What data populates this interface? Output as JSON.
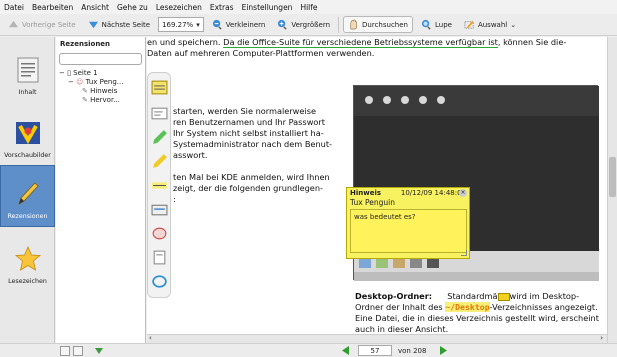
{
  "menubar": {
    "items": [
      "Datei",
      "Bearbeiten",
      "Ansicht",
      "Gehe zu",
      "Lesezeichen",
      "Extras",
      "Einstellungen",
      "Hilfe"
    ]
  },
  "toolbar": {
    "prev_page": "Vorherige Seite",
    "next_page": "Nächste Seite",
    "zoom": "169.27%",
    "zoom_out": "Verkleinern",
    "zoom_in": "Vergrößern",
    "browse": "Durchsuchen",
    "magnifier": "Lupe",
    "selection": "Auswahl"
  },
  "sidebar": {
    "items": [
      "Inhalt",
      "Vorschaubilder",
      "Rezensionen",
      "Lesezeichen"
    ],
    "selected": "Rezensionen"
  },
  "panel": {
    "title": "Rezensionen",
    "tree": [
      "Seite 1",
      "Tux Peng...",
      "Hinweis",
      "Hervor..."
    ]
  },
  "document": {
    "line1_pre": "en und speichern. ",
    "line1_link": "Da die Office-Suite für verschiedene Betriebssysteme verfügbar ist",
    "line1_post": ", können Sie die-",
    "line2": "Daten auf mehreren Computer-Plattformen verwenden.",
    "para1": [
      "starten, werden Sie normalerweise",
      "ren Benutzernamen und Ihr Passwort",
      "Ihr System nicht selbst installiert ha-",
      "Systemadministrator nach dem Benut-",
      "asswort."
    ],
    "para2": [
      "ten Mal bei KDE anmelden, wird Ihnen",
      "zeigt, der die folgenden grundlegen-",
      ":"
    ],
    "desktop_heading": "Desktop-Ordner:",
    "desktop_line1_pre": "Standardmä",
    "desktop_line1_post": "wird im Desktop-",
    "desktop_line2_pre": "Ordner der Inhalt des ",
    "desktop_path": "~/Desktop",
    "desktop_line2_post": "-Verzeichnisses angezeigt.",
    "desktop_line3": "Eine Datei, die in dieses Verzeichnis gestellt wird, erscheint",
    "desktop_line4": "auch in dieser Ansicht."
  },
  "note": {
    "title": "Hinweis",
    "timestamp": "10/12/09 14:48:04",
    "author": "Tux Penguin",
    "content": "was bedeutet es?"
  },
  "navigation": {
    "page": "57",
    "of_label": "von 208"
  },
  "colors": {
    "sidebar_selected": "#5f8fc9",
    "note_bg": "#f8f160",
    "highlight": "#f1e34a",
    "link_underline": "#2aa836"
  }
}
